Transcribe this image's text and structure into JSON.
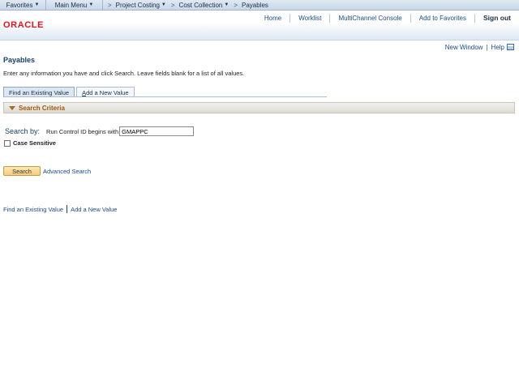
{
  "nav": {
    "favorites": "Favorites",
    "main_menu": "Main Menu",
    "separator": ">",
    "breadcrumbs": [
      "Project Costing",
      "Cost Collection",
      "Payables"
    ]
  },
  "header": {
    "logo": "ORACLE",
    "links": {
      "home": "Home",
      "worklist": "Worklist",
      "multichannel": "MultiChannel Console",
      "add_favorites": "Add to Favorites",
      "sign_out": "Sign out"
    },
    "brand_color": "#e2141b"
  },
  "pagebar": {
    "new_window": "New Window",
    "separator": "|",
    "help": "Help",
    "customize_icon": "customize-page-icon"
  },
  "page": {
    "title": "Payables",
    "instructions": "Enter any information you have and click Search. Leave fields blank for a list of all values.",
    "tabs": {
      "find_existing": "Find an Existing Value",
      "add_new_prefix": "A",
      "add_new_rest": "dd a New Value"
    },
    "section_title": "Search Criteria",
    "search": {
      "search_by": "Search by:",
      "field_label": "Run Control ID",
      "operator": "begins with",
      "value": "GMAPPC",
      "case_sensitive": "Case Sensitive",
      "case_sensitive_checked": false
    },
    "search_button": "Search",
    "advanced_search": "Advanced Search",
    "bottom_links": {
      "find_existing": "Find an Existing Value",
      "add_new": "Add a New Value"
    }
  }
}
